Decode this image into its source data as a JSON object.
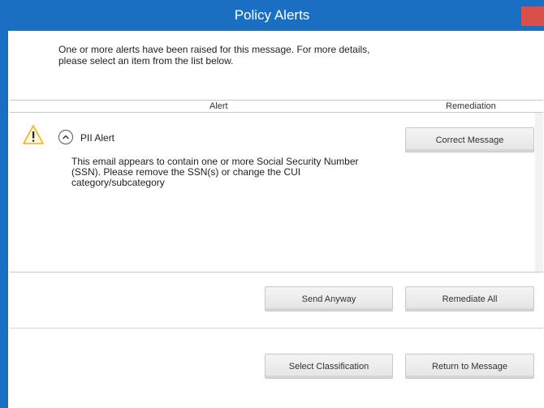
{
  "window": {
    "title": "Policy Alerts"
  },
  "intro_text": "One or more alerts have been raised for this message. For more details, please select an item from the list below.",
  "table": {
    "columns": [
      "Alert",
      "Remediation"
    ]
  },
  "alert": {
    "title": "PII Alert",
    "description": "This email appears to contain one or more Social Security Number (SSN). Please remove the SSN(s) or change the CUI category/subcategory",
    "remediation_label": "Correct Message"
  },
  "buttons": {
    "send_anyway": "Send Anyway",
    "remediate_all": "Remediate All",
    "select_classification": "Select Classification",
    "return_to_message": "Return to Message"
  },
  "colors": {
    "title_bar": "#1b6fc2",
    "close_button": "#d9504a",
    "warning": "#f2b01e"
  },
  "icons": {
    "warning": "warning-triangle-icon",
    "expand": "chevron-up-icon",
    "close": "close-icon"
  }
}
